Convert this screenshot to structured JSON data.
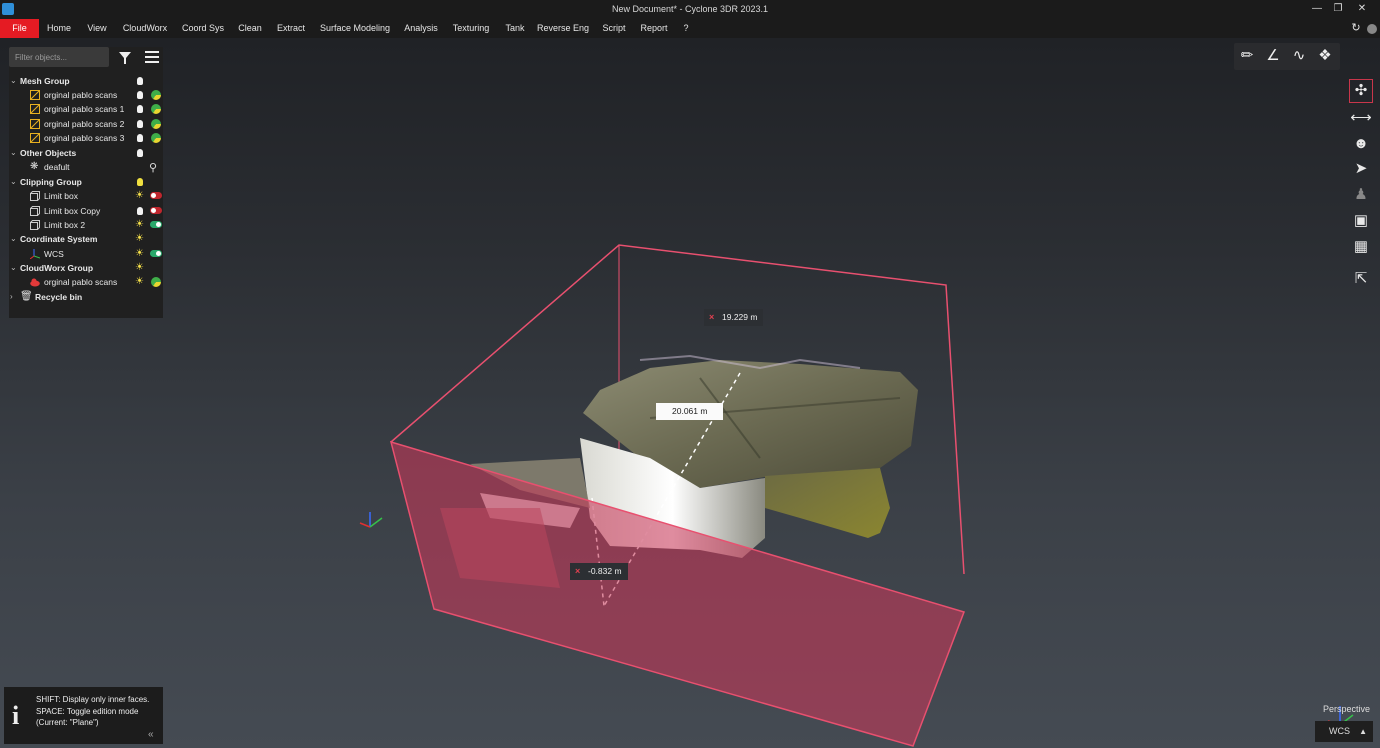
{
  "window": {
    "title": "New Document* - Cyclone 3DR 2023.1"
  },
  "menu": [
    "File",
    "Home",
    "View",
    "CloudWorx",
    "Coord Sys",
    "Clean",
    "Extract",
    "Surface Modeling",
    "Analysis",
    "Texturing",
    "Tank",
    "Reverse Eng",
    "Script",
    "Report",
    "?"
  ],
  "tree": {
    "filter_placeholder": "Filter objects...",
    "mesh_group": {
      "label": "Mesh Group",
      "items": [
        "orginal pablo scans",
        "orginal pablo scans 1",
        "orginal pablo scans 2",
        "orginal pablo scans 3"
      ]
    },
    "other_objects": {
      "label": "Other Objects",
      "items": [
        "deafult"
      ]
    },
    "clipping_group": {
      "label": "Clipping Group",
      "items": [
        "Limit box",
        "Limit box Copy",
        "Limit box 2"
      ]
    },
    "coordinate_system": {
      "label": "Coordinate System",
      "items": [
        "WCS"
      ]
    },
    "cloudworx_group": {
      "label": "CloudWorx Group",
      "items": [
        "orginal pablo scans"
      ]
    },
    "recycle_bin": {
      "label": "Recycle bin"
    }
  },
  "measurements": {
    "top": "19.229 m",
    "center": "20.061 m",
    "bottom": "-0.832 m"
  },
  "tip": {
    "line1": "SHIFT: Display only inner faces.",
    "line2": "SPACE: Toggle edition mode (Current: \"Plane\")"
  },
  "view": {
    "projection": "Perspective",
    "coord_system": "WCS"
  },
  "colors": {
    "file_menu": "#e51b23",
    "clip_box": "#e8506f",
    "toggle_on": "#2aa86b",
    "toggle_off": "#c0262e"
  }
}
